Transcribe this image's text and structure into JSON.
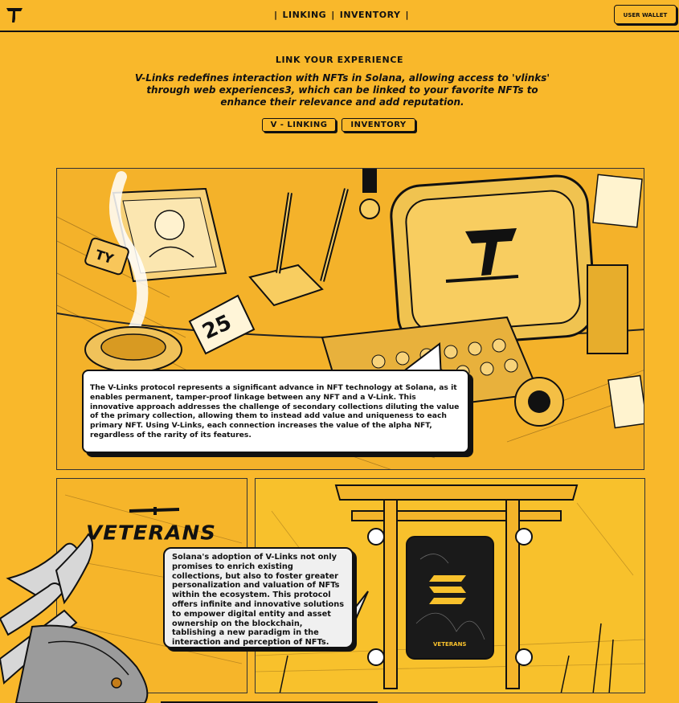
{
  "header": {
    "logo_icon": "ty-logo-icon",
    "nav": {
      "sep": "|",
      "linking": "LINKING",
      "inventory": "INVENTORY"
    },
    "wallet_button": "USER WALLET"
  },
  "hero": {
    "title": "LINK YOUR EXPERIENCE",
    "intro": "V-Links redefines interaction with NFTs in Solana, allowing access to 'vlinks' through web experiences3, which can be linked to your favorite NFTs to enhance their relevance and add reputation.",
    "tabs": [
      "V - LINKING",
      "INVENTORY"
    ]
  },
  "panel_main": {
    "calendar_day": "25",
    "badge_text": "TY",
    "bubble_text": "The V-Links protocol represents a significant advance in NFT technology at Solana, as it enables permanent, tamper-proof linkage between any NFT and a V-Link. This innovative approach addresses the challenge of secondary collections diluting the value of the primary collection, allowing them to instead add value and uniqueness to each primary NFT. Using V-Links, each connection increases the value of the alpha NFT, regardless of the rarity of its features."
  },
  "panel_left": {
    "title": "VETERANS"
  },
  "panel_right": {
    "bubble_text": "Solana's adoption of V-Links not only promises to enrich existing collections, but also to foster greater personalization and valuation of NFTs within the ecosystem. This protocol offers infinite and innovative solutions to empower digital entity and asset ownership on the blockchain, tablishing a new paradigm in the interaction and perception of NFTs.",
    "card_label": "VETERANS"
  },
  "colors": {
    "background": "#f9b82b",
    "ink": "#111111",
    "bubble": "#ffffff"
  }
}
